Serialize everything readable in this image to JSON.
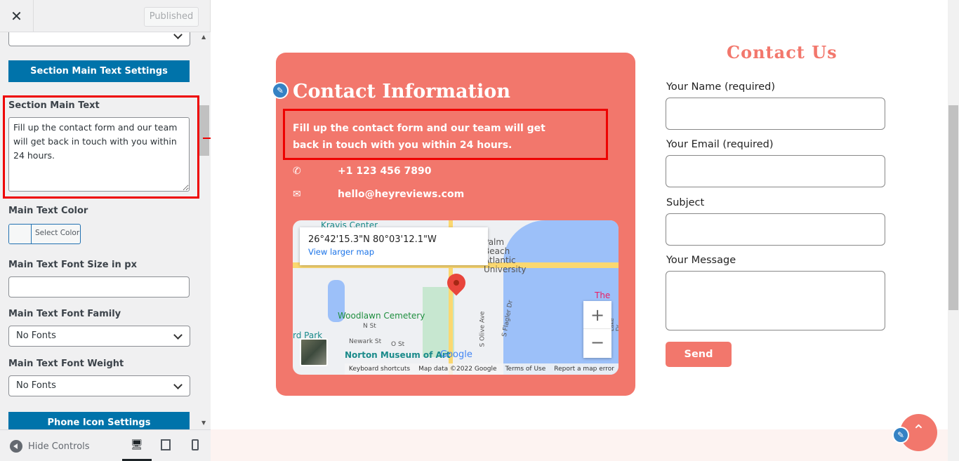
{
  "sidebar": {
    "published_label": "Published",
    "section_button": "Section Main Text Settings",
    "main_text_label": "Section Main Text",
    "main_text_value": "Fill up the contact form and our team will get back in touch with you within 24 hours.",
    "color_label": "Main Text Color",
    "select_color": "Select Color",
    "font_size_label": "Main Text Font Size in px",
    "font_family_label": "Main Text Font Family",
    "font_family_value": "No Fonts",
    "font_weight_label": "Main Text Font Weight",
    "font_weight_value": "No Fonts",
    "phone_button": "Phone Icon Settings",
    "hide_controls": "Hide Controls"
  },
  "contact_info": {
    "title": "Contact Information",
    "main_text": "Fill up the contact form and our team will get back in touch with you within 24 hours.",
    "phone": "+1 123 456 7890",
    "email": "hello@heyreviews.com"
  },
  "map": {
    "coords": "26°42'15.3\"N 80°03'12.1\"W",
    "view_larger": "View larger map",
    "labels": [
      "Kravis Center",
      "Palm Beach Atlantic University",
      "Woodlawn Cemetery",
      "N St",
      "Newark St",
      "O St",
      "Norton Museum of Art",
      "S Olive Ave",
      "S Flagler Dr",
      "The B",
      "S Lake Dr",
      "rd Park"
    ],
    "google": "Google",
    "attribution": [
      "Keyboard shortcuts",
      "Map data ©2022 Google",
      "Terms of Use",
      "Report a map error"
    ]
  },
  "form": {
    "title": "Contact Us",
    "name_label": "Your Name (required)",
    "email_label": "Your Email (required)",
    "subject_label": "Subject",
    "message_label": "Your Message",
    "send": "Send"
  },
  "colors": {
    "accent": "#f2776c",
    "wp_blue": "#0073aa"
  }
}
